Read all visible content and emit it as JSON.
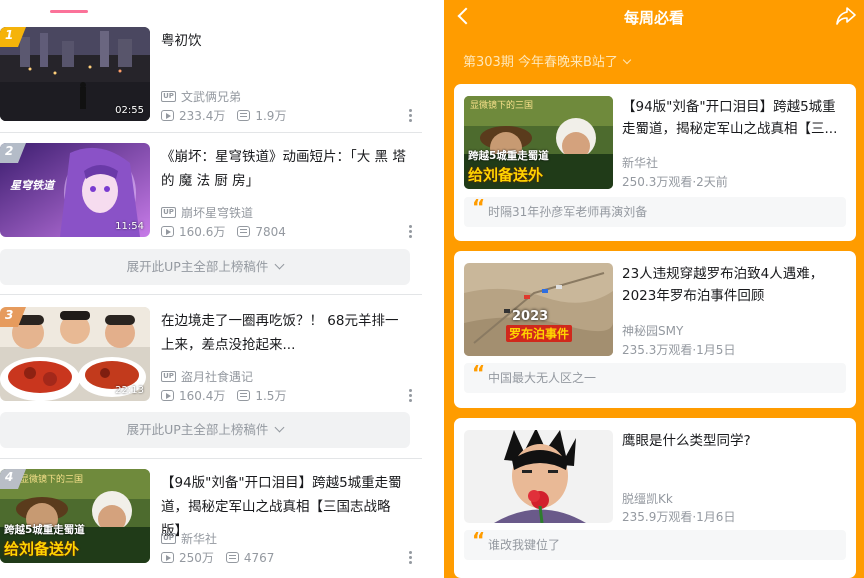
{
  "left": {
    "items": [
      {
        "rank": "1",
        "title": "粤初饮",
        "duration": "02:55",
        "uploader": "文武俩兄弟",
        "views": "233.4万",
        "danmaku": "1.9万"
      },
      {
        "rank": "2",
        "title": "《崩坏：星穹铁道》动画短片：「大 黑 塔 的 魔 法 厨 房」",
        "duration": "11:54",
        "uploader": "崩坏星穹铁道",
        "views": "160.6万",
        "danmaku": "7804"
      },
      {
        "rank": "3",
        "title": "在边境走了一圈再吃饭？！ 68元羊排一上来，差点没抢起来...",
        "duration": "22:13",
        "uploader": "盗月社食遇记",
        "views": "160.4万",
        "danmaku": "1.5万"
      },
      {
        "rank": "4",
        "title": "【94版\"刘备\"开口泪目】跨越5城重走蜀道，揭秘定军山之战真相【三国志战略版】",
        "duration": "",
        "uploader": "新华社",
        "views": "250万",
        "danmaku": "4767"
      }
    ],
    "expand_label": "展开此UP主全部上榜稿件",
    "up_tag": "UP"
  },
  "right": {
    "nav_title": "每周必看",
    "issue": "第303期 今年春晚来B站了",
    "cards": [
      {
        "title": "【94版\"刘备\"开口泪目】跨越5城重走蜀道，揭秘定军山之战真相【三...",
        "uploader": "新华社",
        "stats": "250.3万观看·2天前",
        "reason": "时隔31年孙彦军老师再演刘备"
      },
      {
        "title": "23人违规穿越罗布泊致4人遇难，2023年罗布泊事件回顾",
        "uploader": "神秘园SMY",
        "stats": "235.3万观看·1月5日",
        "reason": "中国最大无人区之一"
      },
      {
        "title": "鹰眼是什么类型同学?",
        "uploader": "脱缰凯Kk",
        "stats": "235.9万观看·1月6日",
        "reason": "谁改我键位了"
      }
    ]
  },
  "thumb_text": {
    "kingdoms_caption": "跨越5城重走蜀道",
    "kingdoms_main": "给刘备送外",
    "kingdoms_top": "显微镜下的三国",
    "lop_year": "2023",
    "lop_caption": "罗布泊事件",
    "hsr_logo": "星穹铁道"
  },
  "colors": {
    "accent_pink": "#fb7299",
    "orange": "#ff9c00",
    "meta_gray": "#9499a0"
  }
}
